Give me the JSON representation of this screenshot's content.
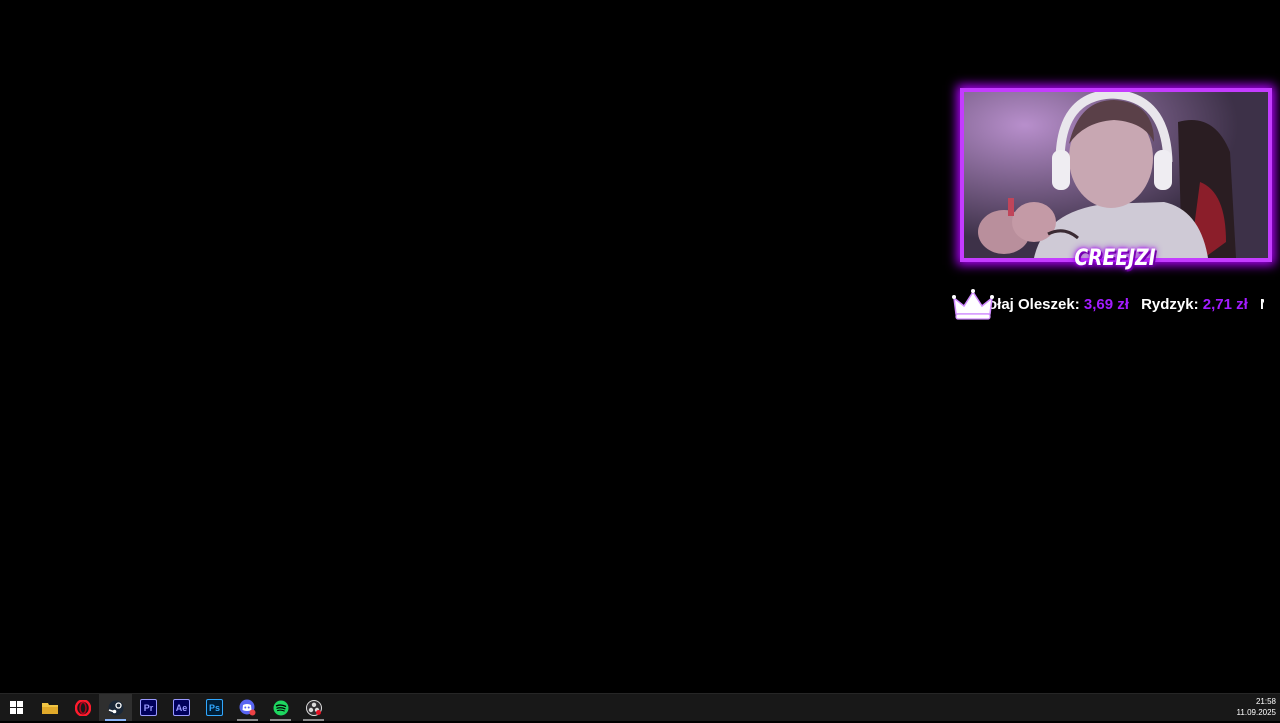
{
  "overlay": {
    "streamer_name": "CREEJZI",
    "frame_color": "#c43cff",
    "accent_color": "#a21cff",
    "ticker": [
      {
        "name": "ołaj Oleszek:",
        "amount": "3,69 zł"
      },
      {
        "name": "Rydzyk:",
        "amount": "2,71 zł"
      },
      {
        "name": "N",
        "amount": ""
      }
    ]
  },
  "taskbar": {
    "items": [
      {
        "name": "windows-start",
        "icon": "windows-logo-icon"
      },
      {
        "name": "file-explorer",
        "icon": "folder-icon"
      },
      {
        "name": "opera",
        "icon": "opera-icon"
      },
      {
        "name": "steam",
        "icon": "steam-icon",
        "active": true
      },
      {
        "name": "premiere-pro",
        "icon": "premiere-pro-icon",
        "label": "Pr"
      },
      {
        "name": "after-effects",
        "icon": "after-effects-icon",
        "label": "Ae"
      },
      {
        "name": "photoshop",
        "icon": "photoshop-icon",
        "label": "Ps"
      },
      {
        "name": "discord",
        "icon": "discord-icon"
      },
      {
        "name": "spotify",
        "icon": "spotify-icon"
      },
      {
        "name": "obs",
        "icon": "obs-icon"
      }
    ],
    "clock": {
      "time": "21:58",
      "date": "11.09.2025"
    }
  }
}
